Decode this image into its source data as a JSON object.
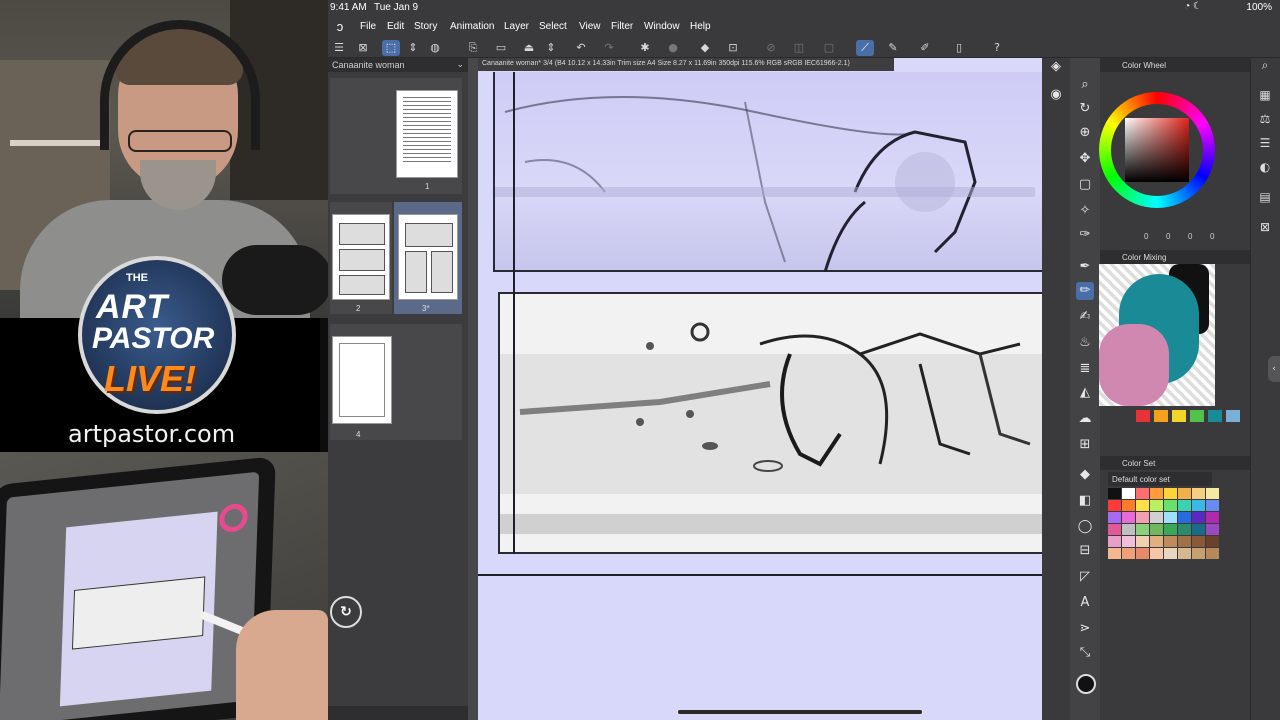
{
  "stream": {
    "show_top_small": "THE",
    "logo_line1": "ART",
    "logo_line2": "PASTOR",
    "logo_line3": "LIVE!",
    "website": "artpastor.com"
  },
  "status_bar": {
    "time": "9:41 AM",
    "date": "Tue Jan 9",
    "battery": "100%"
  },
  "menu": [
    "File",
    "Edit",
    "Story",
    "Animation",
    "Layer",
    "Select",
    "View",
    "Filter",
    "Window",
    "Help"
  ],
  "page_manager": {
    "title": "Canaanite woman",
    "pages": [
      "1",
      "2",
      "3*",
      "4"
    ]
  },
  "canvas": {
    "tab_label": "Canaanite woman* 3/4 (B4 10.12 x 14.33in Trim size A4 Size 8.27 x 11.69in 350dpi 115.6%  RGB sRGB IEC61966-2.1)"
  },
  "color_wheel": {
    "title": "Color Wheel",
    "values": [
      "0",
      "0",
      "0",
      "0"
    ]
  },
  "color_mixing": {
    "title": "Color Mixing",
    "swatches": [
      "#e8323a",
      "#f4a21c",
      "#f2d52a",
      "#52c24a",
      "#1a8a96",
      "#7ab0d8"
    ]
  },
  "color_set": {
    "title": "Color Set",
    "set_name": "Default color set",
    "colors": [
      "#111111",
      "#ffffff",
      "#ff6e6e",
      "#ff9a3a",
      "#ffd23a",
      "#f2b04a",
      "#f6d080",
      "#f3e9a0",
      "#ff3a3a",
      "#ff7a2a",
      "#ffe04a",
      "#b8f060",
      "#6ae070",
      "#3ad2b0",
      "#3ab8e8",
      "#6a8af0",
      "#a86af0",
      "#e66ad8",
      "#f0a0b0",
      "#d0d0d0",
      "#a0e0ff",
      "#2a6ae0",
      "#5a2ac0",
      "#b02ab0",
      "#e05a9a",
      "#c0c0c0",
      "#8ad07a",
      "#70b860",
      "#3aa858",
      "#2a8a6a",
      "#1a6a8a",
      "#9a4ac0",
      "#e8a0c8",
      "#f0c0d8",
      "#f0d0b0",
      "#e0b080",
      "#c08a5a",
      "#a07048",
      "#8a5a38",
      "#6a4228",
      "#f4b890",
      "#f0a078",
      "#e88a6a",
      "#f6c6a8",
      "#e8d6c0",
      "#d6b890",
      "#c6a070",
      "#b6885a"
    ]
  }
}
